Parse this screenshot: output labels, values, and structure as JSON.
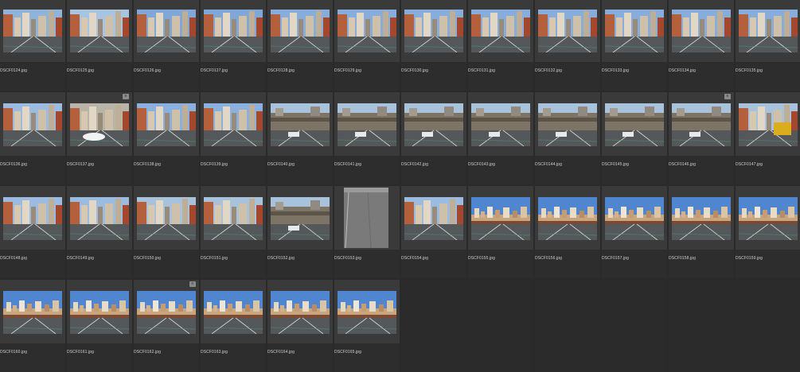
{
  "browser": {
    "items": [
      {
        "file": "DSCF0124.jpg",
        "scene": "street",
        "sky": "#8fb3d9"
      },
      {
        "file": "DSCF0125.jpg",
        "scene": "street",
        "sky": "#a7c4e2"
      },
      {
        "file": "DSCF0126.jpg",
        "scene": "street",
        "sky": "#7fa8d8"
      },
      {
        "file": "DSCF0127.jpg",
        "scene": "street",
        "sky": "#7fa8d8"
      },
      {
        "file": "DSCF0128.jpg",
        "scene": "street",
        "sky": "#86addb"
      },
      {
        "file": "DSCF0129.jpg",
        "scene": "street",
        "sky": "#86addb"
      },
      {
        "file": "DSCF0130.jpg",
        "scene": "street",
        "sky": "#86addb"
      },
      {
        "file": "DSCF0131.jpg",
        "scene": "street",
        "sky": "#86addb"
      },
      {
        "file": "DSCF0132.jpg",
        "scene": "street",
        "sky": "#86addb"
      },
      {
        "file": "DSCF0133.jpg",
        "scene": "street",
        "sky": "#86addb"
      },
      {
        "file": "DSCF0134.jpg",
        "scene": "street",
        "sky": "#86addb"
      },
      {
        "file": "DSCF0135.jpg",
        "scene": "street",
        "sky": "#86addb"
      },
      {
        "file": "DSCF0136.jpg",
        "scene": "city",
        "sky": "#9bbbe0"
      },
      {
        "file": "DSCF0137.jpg",
        "scene": "car",
        "sky": "#b9b4a8",
        "badge": true
      },
      {
        "file": "DSCF0138.jpg",
        "scene": "city",
        "sky": "#8ab1dd"
      },
      {
        "file": "DSCF0139.jpg",
        "scene": "city",
        "sky": "#8ab1dd"
      },
      {
        "file": "DSCF0140.jpg",
        "scene": "overpass",
        "sky": "#a9c2dc"
      },
      {
        "file": "DSCF0141.jpg",
        "scene": "overpass",
        "sky": "#a9c2dc"
      },
      {
        "file": "DSCF0142.jpg",
        "scene": "overpass",
        "sky": "#a9c2dc"
      },
      {
        "file": "DSCF0143.jpg",
        "scene": "overpass",
        "sky": "#a9c2dc"
      },
      {
        "file": "DSCF0144.jpg",
        "scene": "overpass",
        "sky": "#a9c2dc"
      },
      {
        "file": "DSCF0145.jpg",
        "scene": "overpass",
        "sky": "#a9c2dc"
      },
      {
        "file": "DSCF0146.jpg",
        "scene": "overpass",
        "sky": "#a9c2dc",
        "badge": true
      },
      {
        "file": "DSCF0147.jpg",
        "scene": "bus",
        "sky": "#a9c2dc"
      },
      {
        "file": "DSCF0148.jpg",
        "scene": "city",
        "sky": "#9bbbe0"
      },
      {
        "file": "DSCF0149.jpg",
        "scene": "city",
        "sky": "#9bbbe0"
      },
      {
        "file": "DSCF0150.jpg",
        "scene": "city",
        "sky": "#a9c2dc"
      },
      {
        "file": "DSCF0151.jpg",
        "scene": "city",
        "sky": "#a9c2dc"
      },
      {
        "file": "DSCF0152.jpg",
        "scene": "overpass",
        "sky": "#a9c2dc"
      },
      {
        "file": "DSCF0153.jpg",
        "scene": "pavement",
        "sky": "#8c8c8c",
        "portrait": true
      },
      {
        "file": "DSCF0154.jpg",
        "scene": "street",
        "sky": "#9bbbe0"
      },
      {
        "file": "DSCF0155.jpg",
        "scene": "skyline",
        "sky": "#4f86cf"
      },
      {
        "file": "DSCF0156.jpg",
        "scene": "skyline",
        "sky": "#4f86cf"
      },
      {
        "file": "DSCF0157.jpg",
        "scene": "skyline",
        "sky": "#4f86cf"
      },
      {
        "file": "DSCF0158.jpg",
        "scene": "skyline",
        "sky": "#4f86cf"
      },
      {
        "file": "DSCF0159.jpg",
        "scene": "skyline",
        "sky": "#4f86cf"
      },
      {
        "file": "DSCF0160.jpg",
        "scene": "skyline",
        "sky": "#4f86cf"
      },
      {
        "file": "DSCF0161.jpg",
        "scene": "skyline",
        "sky": "#4f86cf"
      },
      {
        "file": "DSCF0162.jpg",
        "scene": "skyline",
        "sky": "#4f86cf",
        "badge": true
      },
      {
        "file": "DSCF0163.jpg",
        "scene": "skyline",
        "sky": "#4f86cf"
      },
      {
        "file": "DSCF0164.jpg",
        "scene": "skyline",
        "sky": "#4f86cf"
      },
      {
        "file": "DSCF0165.jpg",
        "scene": "skyline",
        "sky": "#4f86cf"
      }
    ],
    "empty_cells": 6,
    "badge_glyph": "≡",
    "colors": {
      "background": "#2a2a2a",
      "cell": "#2d2d2d",
      "well": "#3a3a3a",
      "label": "#cfcfcf"
    }
  }
}
